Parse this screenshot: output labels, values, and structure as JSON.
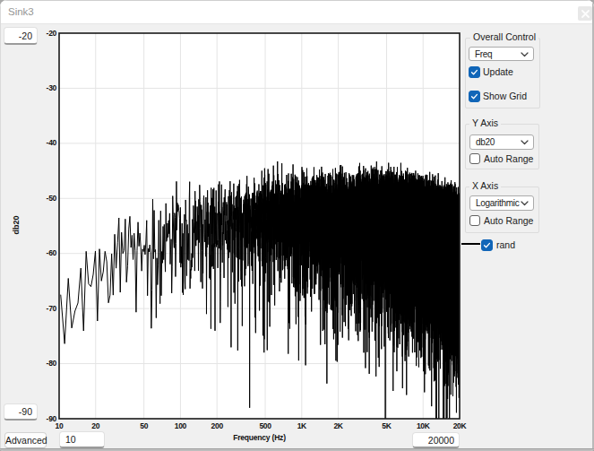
{
  "window": {
    "title": "Sink3"
  },
  "controls": {
    "y_max_value": "-20",
    "y_min_value": "-90",
    "x_min_value": "10",
    "x_max_value": "20000",
    "advanced_label": "Advanced"
  },
  "panel": {
    "groups": [
      {
        "legend": "Overall Control",
        "combo": {
          "value": "Freq"
        },
        "checkboxes": [
          {
            "label": "Update",
            "checked": true
          },
          {
            "label": "Show Grid",
            "checked": true
          }
        ]
      },
      {
        "legend": "Y Axis",
        "combo": {
          "value": "db20"
        },
        "checkboxes": [
          {
            "label": "Auto Range",
            "checked": false
          }
        ]
      },
      {
        "legend": "X Axis",
        "combo": {
          "value": "Logarithmic"
        },
        "checkboxes": [
          {
            "label": "Auto Range",
            "checked": false
          }
        ]
      }
    ],
    "trace_legend": {
      "label": "rand",
      "checked": true,
      "line_color": "#000000"
    }
  },
  "chart_data": {
    "type": "line",
    "title": "",
    "xlabel": "Frequency (Hz)",
    "ylabel": "db20",
    "x_scale": "logarithmic",
    "x_range": [
      10,
      20000
    ],
    "y_range": [
      -90,
      -20
    ],
    "x_tick_values": [
      10,
      20,
      50,
      100,
      200,
      500,
      1000,
      2000,
      5000,
      10000,
      20000
    ],
    "x_tick_labels": [
      "10",
      "20",
      "50",
      "100",
      "200",
      "500",
      "1K",
      "2K",
      "5K",
      "10K",
      "20K"
    ],
    "y_tick_values": [
      -20,
      -30,
      -40,
      -50,
      -60,
      -70,
      -80,
      -90
    ],
    "y_tick_labels": [
      "-20",
      "-30",
      "-40",
      "-50",
      "-60",
      "-70",
      "-80",
      "-90"
    ],
    "grid": true,
    "grid_color": "#e4e4e4",
    "frame_color": "#1a1a1a",
    "series": [
      {
        "name": "rand",
        "color": "#000000",
        "source": "fft-noise-spectrum",
        "seed": 9,
        "f_start": 10.3,
        "f_step": 0.8,
        "f_end": 20400,
        "envelope_db": [
          [
            10,
            -70
          ],
          [
            15,
            -64
          ],
          [
            20,
            -60.5
          ],
          [
            30,
            -58.5
          ],
          [
            50,
            -56.5
          ],
          [
            80,
            -55
          ],
          [
            150,
            -53.5
          ],
          [
            300,
            -52.2
          ],
          [
            700,
            -52.1
          ],
          [
            1500,
            -51.9
          ],
          [
            3000,
            -52.0
          ],
          [
            5000,
            -52.2
          ],
          [
            8000,
            -53.2
          ],
          [
            12000,
            -54.3
          ],
          [
            16000,
            -55.3
          ],
          [
            20000,
            -56.5
          ]
        ],
        "floor_db": -90
      }
    ]
  }
}
